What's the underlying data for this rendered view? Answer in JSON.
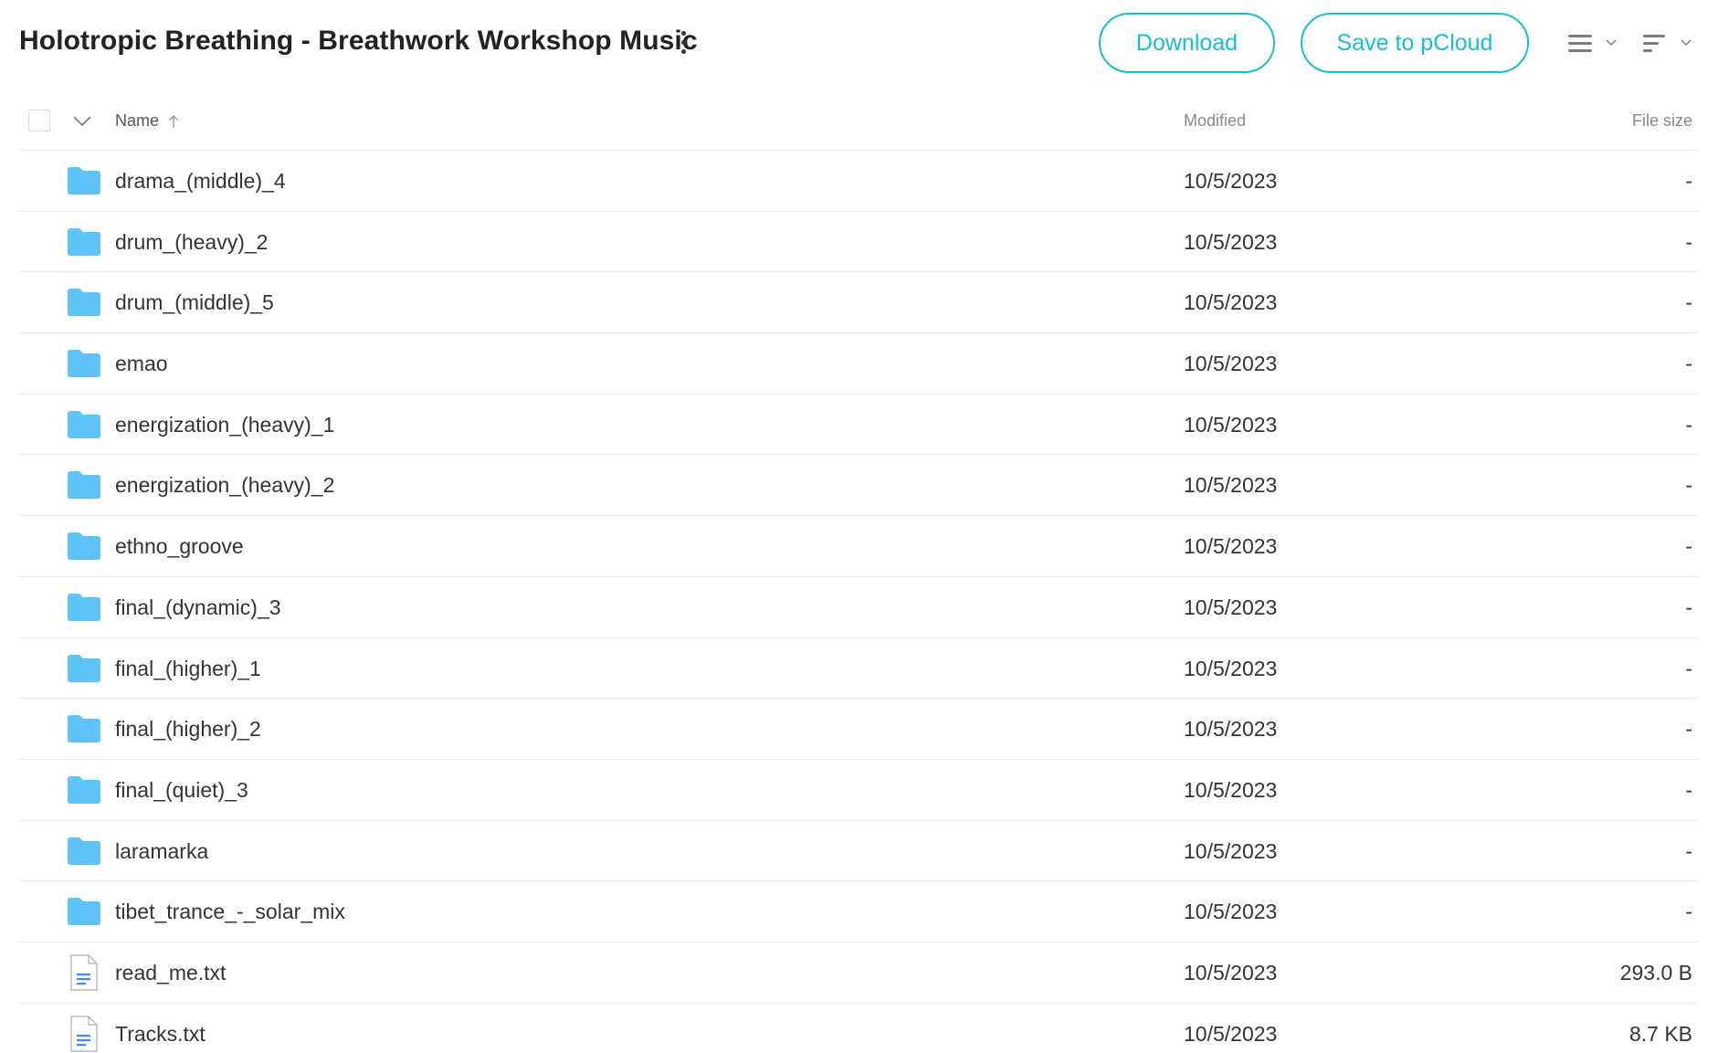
{
  "header": {
    "title": "Holotropic Breathing - Breathwork Workshop Music",
    "download_label": "Download",
    "save_label": "Save to pCloud"
  },
  "columns": {
    "name": "Name",
    "modified": "Modified",
    "size": "File size"
  },
  "colors": {
    "accent": "#17bed0",
    "folder": "#5ec4f7",
    "file_line": "#3b8ff0"
  },
  "rows": [
    {
      "name": "drama_(middle)_4",
      "modified": "10/5/2023",
      "size": "-",
      "type": "folder"
    },
    {
      "name": "drum_(heavy)_2",
      "modified": "10/5/2023",
      "size": "-",
      "type": "folder"
    },
    {
      "name": "drum_(middle)_5",
      "modified": "10/5/2023",
      "size": "-",
      "type": "folder"
    },
    {
      "name": "emao",
      "modified": "10/5/2023",
      "size": "-",
      "type": "folder"
    },
    {
      "name": "energization_(heavy)_1",
      "modified": "10/5/2023",
      "size": "-",
      "type": "folder"
    },
    {
      "name": "energization_(heavy)_2",
      "modified": "10/5/2023",
      "size": "-",
      "type": "folder"
    },
    {
      "name": "ethno_groove",
      "modified": "10/5/2023",
      "size": "-",
      "type": "folder"
    },
    {
      "name": "final_(dynamic)_3",
      "modified": "10/5/2023",
      "size": "-",
      "type": "folder"
    },
    {
      "name": "final_(higher)_1",
      "modified": "10/5/2023",
      "size": "-",
      "type": "folder"
    },
    {
      "name": "final_(higher)_2",
      "modified": "10/5/2023",
      "size": "-",
      "type": "folder"
    },
    {
      "name": "final_(quiet)_3",
      "modified": "10/5/2023",
      "size": "-",
      "type": "folder"
    },
    {
      "name": "laramarka",
      "modified": "10/5/2023",
      "size": "-",
      "type": "folder"
    },
    {
      "name": "tibet_trance_-_solar_mix",
      "modified": "10/5/2023",
      "size": "-",
      "type": "folder"
    },
    {
      "name": "read_me.txt",
      "modified": "10/5/2023",
      "size": "293.0 B",
      "type": "file"
    },
    {
      "name": "Tracks.txt",
      "modified": "10/5/2023",
      "size": "8.7 KB",
      "type": "file"
    }
  ]
}
